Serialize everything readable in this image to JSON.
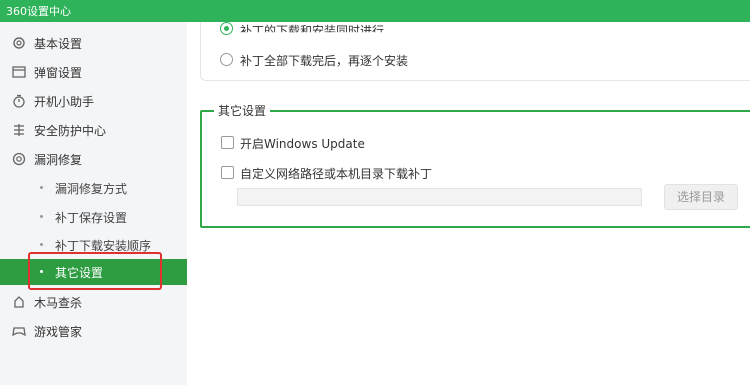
{
  "window": {
    "title": "360设置中心"
  },
  "sidebar": {
    "items": [
      {
        "label": "基本设置",
        "icon": "gear-icon"
      },
      {
        "label": "弹窗设置",
        "icon": "window-icon"
      },
      {
        "label": "开机小助手",
        "icon": "timer-icon"
      },
      {
        "label": "安全防护中心",
        "icon": "shield-grid-icon"
      },
      {
        "label": "漏洞修复",
        "icon": "patch-icon"
      }
    ],
    "sub_items": [
      {
        "label": "漏洞修复方式"
      },
      {
        "label": "补丁保存设置"
      },
      {
        "label": "补丁下载安装顺序"
      },
      {
        "label": "其它设置",
        "active": true
      }
    ],
    "bottom_items": [
      {
        "label": "木马查杀",
        "icon": "trojan-icon"
      },
      {
        "label": "游戏管家",
        "icon": "gamepad-icon"
      }
    ]
  },
  "install_order": {
    "option1": "补丁的下载和安装同时进行",
    "option2": "补丁全部下载完后，再逐个安装",
    "selected": 1
  },
  "other_settings": {
    "title": "其它设置",
    "windows_update_label": "开启Windows Update",
    "custom_path_label": "自定义网络路径或本机目录下载补丁",
    "path_value": "",
    "choose_dir_label": "选择目录"
  },
  "colors": {
    "accent": "#2fb35a",
    "active_bg": "#2e9c41",
    "highlight": "#e03030"
  }
}
